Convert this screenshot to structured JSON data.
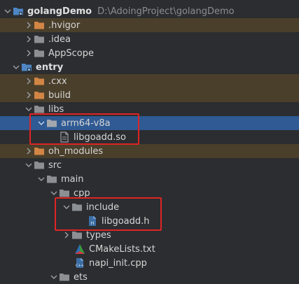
{
  "project": {
    "name": "golangDemo",
    "path": "D:\\AdoingProject\\golangDemo"
  },
  "nodes": {
    "hvigor": ".hvigor",
    "idea": ".idea",
    "appscope": "AppScope",
    "entry": "entry",
    "cxx": ".cxx",
    "build": "build",
    "libs": "libs",
    "arm64": "arm64-v8a",
    "libso": "libgoadd.so",
    "oh_modules": "oh_modules",
    "src": "src",
    "main": "main",
    "cpp": "cpp",
    "include": "include",
    "libh": "libgoadd.h",
    "types": "types",
    "cmake": "CMakeLists.txt",
    "napi": "napi_init.cpp",
    "ets": "ets"
  },
  "colors": {
    "background": "#2b2d30",
    "selection": "#2f5a93",
    "excluded_highlight": "#4a3f2b",
    "annotation": "#e02424",
    "folder": "#8c8f94",
    "excluded_folder": "#d28545",
    "module_folder": "#4e86c4"
  },
  "icons": {
    "expanded": "chevron-down-icon",
    "collapsed": "chevron-right-icon",
    "folder": "folder-icon",
    "file": "file-icon",
    "header": "header-file-icon",
    "cmake": "cmake-icon",
    "cpp": "cpp-file-icon"
  }
}
